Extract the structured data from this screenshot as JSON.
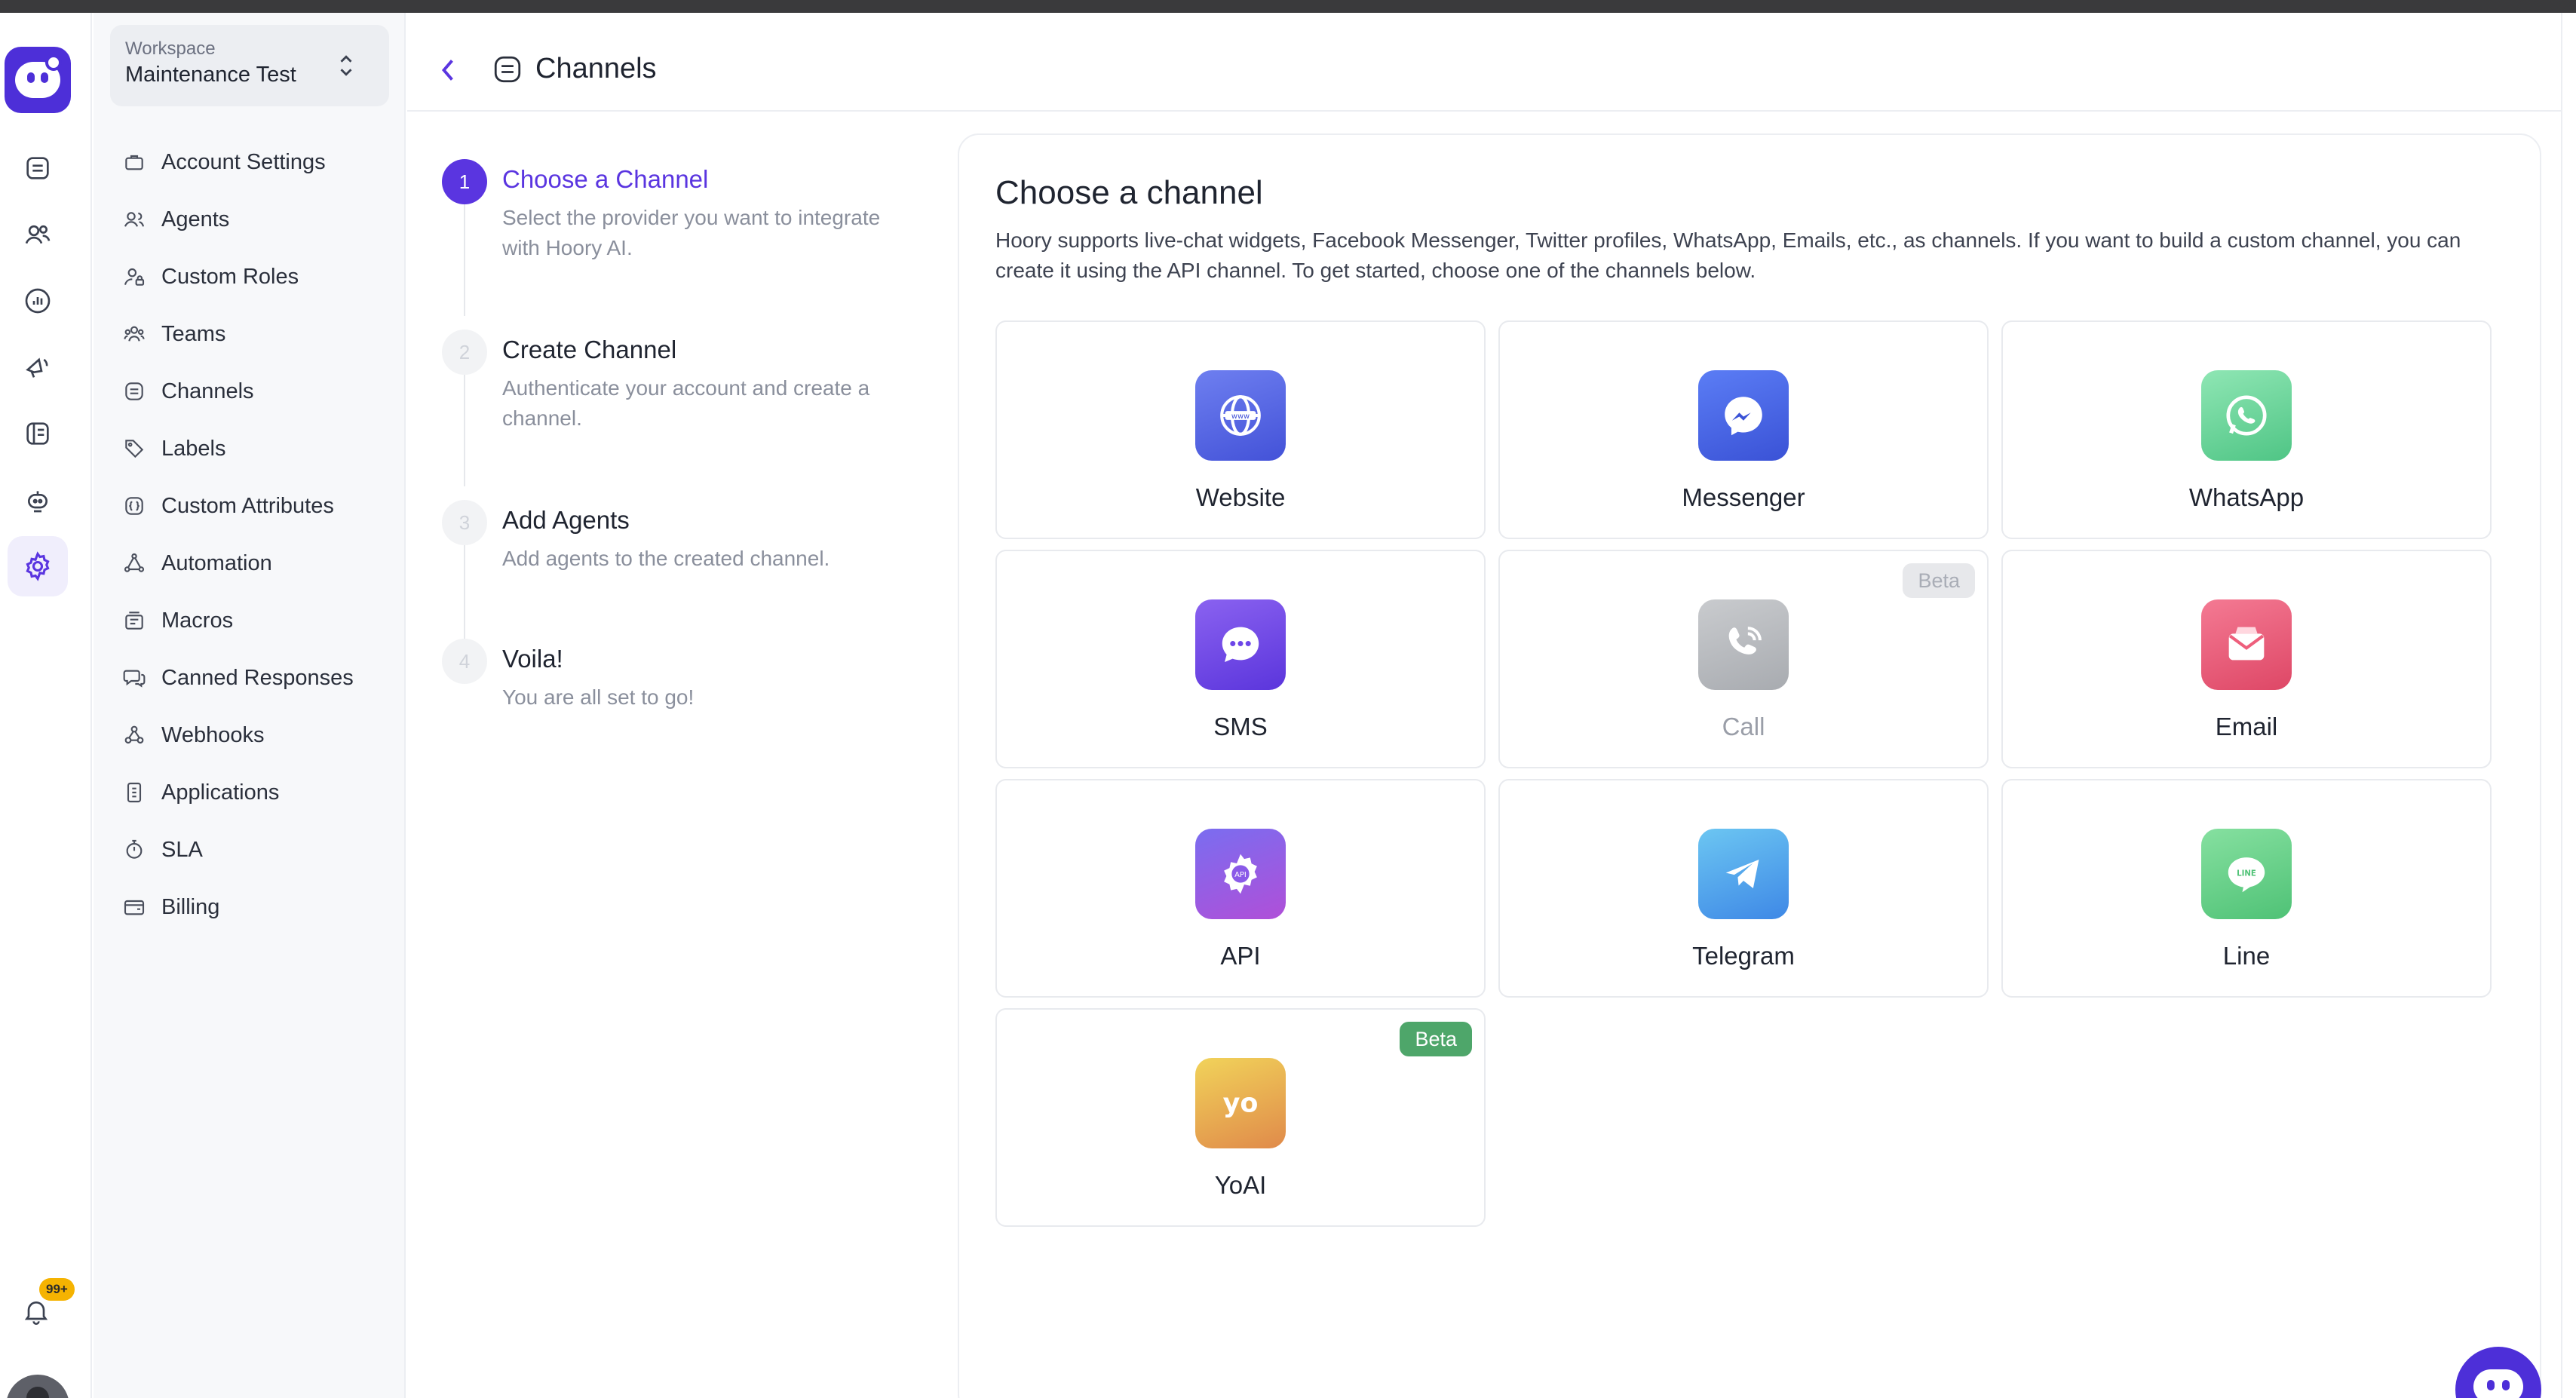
{
  "workspace": {
    "label": "Workspace",
    "name": "Maintenance Test"
  },
  "notifications": {
    "badge": "99+"
  },
  "settings_nav": [
    {
      "label": "Account Settings",
      "icon": "briefcase-icon"
    },
    {
      "label": "Agents",
      "icon": "users-icon"
    },
    {
      "label": "Custom Roles",
      "icon": "user-lock-icon"
    },
    {
      "label": "Teams",
      "icon": "team-icon"
    },
    {
      "label": "Channels",
      "icon": "inbox-icon"
    },
    {
      "label": "Labels",
      "icon": "tag-icon"
    },
    {
      "label": "Custom Attributes",
      "icon": "code-icon"
    },
    {
      "label": "Automation",
      "icon": "flow-icon"
    },
    {
      "label": "Macros",
      "icon": "macro-icon"
    },
    {
      "label": "Canned Responses",
      "icon": "chat-bubbles-icon"
    },
    {
      "label": "Webhooks",
      "icon": "webhook-icon"
    },
    {
      "label": "Applications",
      "icon": "apps-icon"
    },
    {
      "label": "SLA",
      "icon": "timer-icon"
    },
    {
      "label": "Billing",
      "icon": "wallet-icon"
    }
  ],
  "header": {
    "title": "Channels"
  },
  "steps": [
    {
      "number": "1",
      "title": "Choose a Channel",
      "desc": "Select the provider you want to integrate with Hoory AI."
    },
    {
      "number": "2",
      "title": "Create Channel",
      "desc": "Authenticate your account and create a channel."
    },
    {
      "number": "3",
      "title": "Add Agents",
      "desc": "Add agents to the created channel."
    },
    {
      "number": "4",
      "title": "Voila!",
      "desc": "You are all set to go!"
    }
  ],
  "panel": {
    "title": "Choose a channel",
    "desc": "Hoory supports live-chat widgets, Facebook Messenger, Twitter profiles, WhatsApp, Emails, etc., as channels. If you want to build a custom channel, you can create it using the API channel. To get started, choose one of the channels below."
  },
  "channels": [
    {
      "name": "Website",
      "icon": "globe-www-icon",
      "color": "#4f63e6"
    },
    {
      "name": "Messenger",
      "icon": "messenger-icon",
      "color": "#4a6cf0"
    },
    {
      "name": "WhatsApp",
      "icon": "whatsapp-icon",
      "color": "#6fd69b"
    },
    {
      "name": "SMS",
      "icon": "sms-bubble-icon",
      "color": "#6d46e8"
    },
    {
      "name": "Call",
      "icon": "phone-call-icon",
      "color": "#b9bbbf",
      "badge": "Beta"
    },
    {
      "name": "Email",
      "icon": "envelope-icon",
      "color": "#ee5f7c"
    },
    {
      "name": "API",
      "icon": "api-gear-icon",
      "color": "#8a5ae8"
    },
    {
      "name": "Telegram",
      "icon": "telegram-icon",
      "color": "#4fa6ee"
    },
    {
      "name": "Line",
      "icon": "line-icon",
      "color": "#6cd48a"
    },
    {
      "name": "YoAI",
      "icon": "yoai-icon",
      "color": "#e8b24a",
      "badge": "Beta"
    }
  ]
}
